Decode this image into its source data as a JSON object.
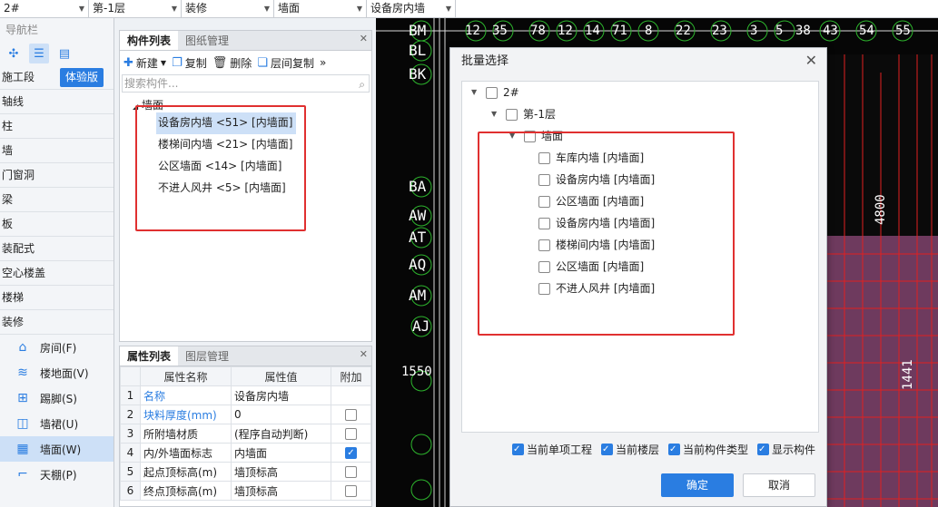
{
  "topbar": {
    "selects": [
      "2#",
      "第-1层",
      "装修",
      "墙面",
      "设备房内墙"
    ]
  },
  "nav": {
    "title": "导航栏",
    "construction_label": "施工段",
    "trial_badge": "体验版",
    "items": [
      "轴线",
      "柱",
      "墙",
      "门窗洞",
      "梁",
      "板",
      "装配式",
      "空心楼盖",
      "楼梯",
      "装修"
    ],
    "sub_items": [
      "房间(F)",
      "楼地面(V)",
      "踢脚(S)",
      "墙裙(U)",
      "墙面(W)",
      "天棚(P)"
    ]
  },
  "component_panel": {
    "tabs": [
      "构件列表",
      "图纸管理"
    ],
    "toolbar": {
      "new": "新建",
      "copy": "复制",
      "delete": "删除",
      "floor_copy": "层间复制",
      "more": "»"
    },
    "search_placeholder": "搜索构件...",
    "tree_root": "墙面",
    "items": [
      "设备房内墙 <51> [内墙面]",
      "楼梯间内墙 <21> [内墙面]",
      "公区墙面 <14> [内墙面]",
      "不进人风井 <5> [内墙面]"
    ]
  },
  "property_panel": {
    "tabs": [
      "属性列表",
      "图层管理"
    ],
    "headers": [
      "属性名称",
      "属性值",
      "附加"
    ],
    "rows": [
      {
        "num": "1",
        "name": "名称",
        "value": "设备房内墙",
        "checkbox": "none"
      },
      {
        "num": "2",
        "name": "块料厚度(mm)",
        "value": "0",
        "checkbox": "off"
      },
      {
        "num": "3",
        "name": "所附墙材质",
        "value": "(程序自动判断)",
        "checkbox": "off"
      },
      {
        "num": "4",
        "name": "内/外墙面标志",
        "value": "内墙面",
        "checkbox": "on"
      },
      {
        "num": "5",
        "name": "起点顶标高(m)",
        "value": "墙顶标高",
        "checkbox": "off"
      },
      {
        "num": "6",
        "name": "终点顶标高(m)",
        "value": "墙顶标高",
        "checkbox": "off"
      }
    ]
  },
  "cad": {
    "axis_left": [
      "BM",
      "BL",
      "BK",
      "BA",
      "AW",
      "AT",
      "AQ",
      "AM",
      "AJ"
    ],
    "axis_top": [
      "12",
      "35",
      "78",
      "12",
      "14",
      "71",
      "8",
      "22",
      "23",
      "3",
      "5",
      "38",
      "43",
      "54",
      "55"
    ],
    "dim1": "4800",
    "dim2": "1441",
    "dim3": "1550"
  },
  "dialog": {
    "title": "批量选择",
    "tree": {
      "building": "2#",
      "floor": "第-1层",
      "category": "墙面",
      "items": [
        "车库内墙 [内墙面]",
        "设备房内墙 [内墙面]",
        "公区墙面 [内墙面]",
        "设备房内墙 [内墙面]",
        "楼梯间内墙 [内墙面]",
        "公区墙面 [内墙面]",
        "不进人风井 [内墙面]"
      ]
    },
    "options": [
      "当前单项工程",
      "当前楼层",
      "当前构件类型",
      "显示构件"
    ],
    "ok_label": "确定",
    "cancel_label": "取消"
  },
  "colors": {
    "accent": "#2a7de1",
    "highlight_red": "#e03030",
    "cad_magenta": "#6e3a5e"
  }
}
